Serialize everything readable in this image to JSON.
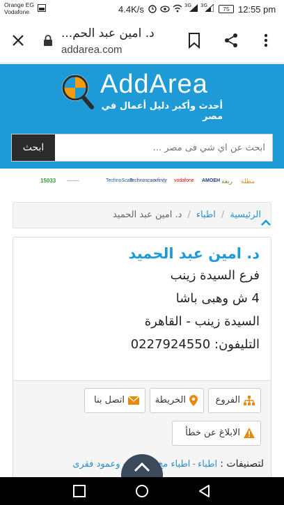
{
  "status_bar": {
    "carrier_line1": "Orange EG",
    "carrier_line2": "Vodafone",
    "network_speed": "4.4K/s",
    "signal_1_label": "3G",
    "signal_2_label": "3G",
    "battery_level": "75",
    "time": "12:55 pm"
  },
  "browser": {
    "tab_title": "د. امين عبد الحم...",
    "url": "addarea.com",
    "icons": [
      "close-icon",
      "lock-icon",
      "bookmark-icon",
      "share-icon",
      "more-vert-icon"
    ]
  },
  "header": {
    "logo_text": "AddArea",
    "tagline": "أحدث وأكبر دليل أعمال في مصر",
    "search_button": "ابحث",
    "search_placeholder": "ابحث عن اي شي فى مصر ..."
  },
  "sponsors": [
    {
      "label": "15033",
      "color": "#2e9a3a"
    },
    {
      "label": "TechnoScan",
      "color": "#1a5f9e"
    },
    {
      "label": "Technoscan",
      "color": "#1e3c7a"
    },
    {
      "label": "xfinity",
      "color": "#1f3c88"
    },
    {
      "label": "vodafone",
      "color": "#e60000"
    },
    {
      "label": "AMOEH",
      "color": "#1b3f7a"
    },
    {
      "label": "ربعة",
      "color": "#6a8a2a"
    },
    {
      "label": "مظلة",
      "color": "#d48b1a"
    }
  ],
  "breadcrumb": {
    "home": "الرئيسية",
    "category": "اطباء",
    "current": "د. امين عبد الحميد"
  },
  "listing": {
    "name": "د. امين عبد الحميد",
    "branch": "فرع السيدة زينب",
    "address": "4 ش وهبى باشا",
    "area": "السيدة زينب - القاهرة",
    "phone_label": "التليفون:",
    "phone": "0227924550"
  },
  "actions": {
    "branches": "الفروع",
    "map": "الخريطة",
    "contact": "اتصل بنا",
    "report": "الابلاغ عن خطأ"
  },
  "categories": {
    "label": "لتصنيفات :",
    "items": [
      "اطباء",
      "اطباء مخ وأعصاب وعمود فقرى"
    ]
  },
  "colors": {
    "brand_blue": "#1e9bd7",
    "link_blue": "#2a8fc9",
    "dark_button": "#2b2b2b",
    "action_green": "#2e8f3a",
    "action_orange": "#e88a0c",
    "action_red": "#c0392b"
  }
}
